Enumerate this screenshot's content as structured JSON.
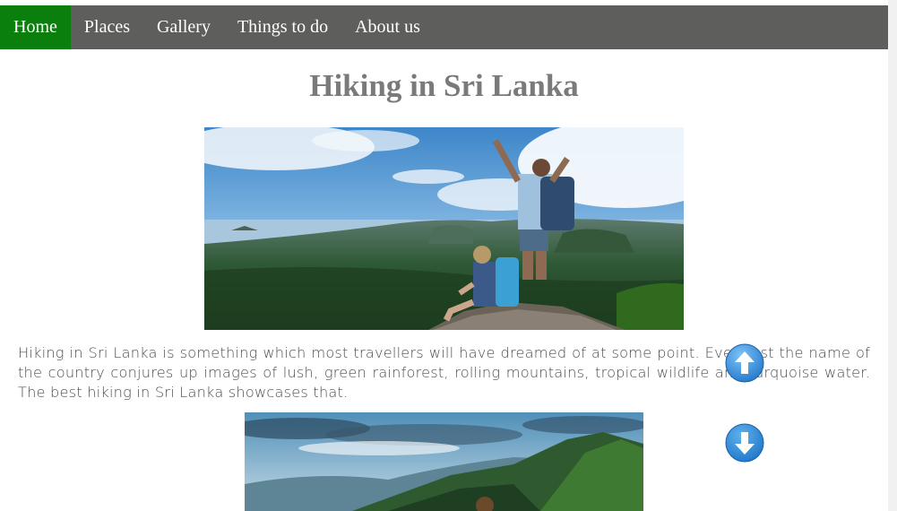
{
  "nav": {
    "items": [
      {
        "label": "Home",
        "active": true
      },
      {
        "label": "Places",
        "active": false
      },
      {
        "label": "Gallery",
        "active": false
      },
      {
        "label": "Things to do",
        "active": false
      },
      {
        "label": "About us",
        "active": false
      }
    ],
    "active_color": "#0a7f0d",
    "bar_color": "#5e5e5c"
  },
  "page": {
    "title": "Hiking in Sri Lanka",
    "intro": "Hiking in Sri Lanka is something which most travellers will have dreamed of at some point. Even just the name of the country conjures up images of lush, green rainforest, rolling mountains, tropical wildlife and turquoise water. The best hiking in Sri Lanka showcases that."
  },
  "images": [
    {
      "name": "hikers-on-summit-photo"
    },
    {
      "name": "mountain-landscape-photo"
    }
  ],
  "controls": {
    "scroll_up_icon": "arrow-up-circle-icon",
    "scroll_down_icon": "arrow-down-circle-icon"
  }
}
